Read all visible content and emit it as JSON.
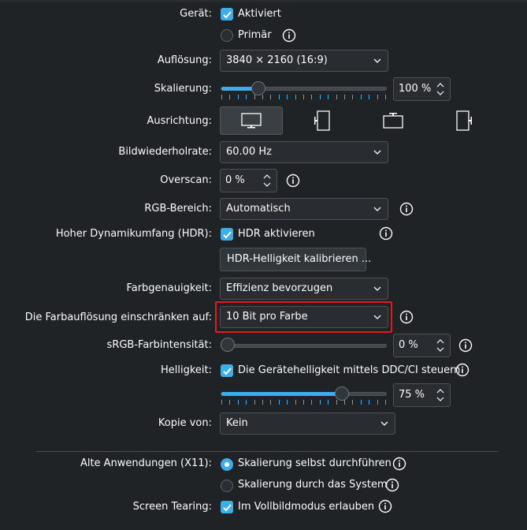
{
  "labels": {
    "device": "Gerät:",
    "resolution": "Auflösung:",
    "scale": "Skalierung:",
    "orientation": "Ausrichtung:",
    "refresh": "Bildwiederholrate:",
    "overscan": "Overscan:",
    "rgb_range": "RGB-Bereich:",
    "hdr": "Hoher Dynamikumfang (HDR):",
    "color_accuracy": "Farbgenauigkeit:",
    "color_depth": "Die Farbauflösung einschränken auf:",
    "srgb": "sRGB-Farbintensität:",
    "brightness": "Helligkeit:",
    "mirror": "Kopie von:",
    "legacy": "Alte Anwendungen (X11):",
    "tearing": "Screen Tearing:"
  },
  "device": {
    "enabled_label": "Aktiviert",
    "enabled": true,
    "primary_label": "Primär",
    "primary": false
  },
  "resolution": {
    "value": "3840 × 2160 (16:9)"
  },
  "scale": {
    "value_text": "100 %",
    "fraction": 0.2
  },
  "orientation": {
    "selected": "landscape"
  },
  "refresh": {
    "value": "60.00 Hz"
  },
  "overscan": {
    "value_text": "0 %"
  },
  "rgb_range": {
    "value": "Automatisch"
  },
  "hdr": {
    "check_label": "HDR aktivieren",
    "checked": true,
    "calibrate_label": "HDR-Helligkeit kalibrieren ..."
  },
  "color_accuracy": {
    "value": "Effizienz bevorzugen"
  },
  "color_depth": {
    "value": "10 Bit pro Farbe"
  },
  "srgb": {
    "value_text": "0 %",
    "fraction": 0.0
  },
  "brightness": {
    "check_label": "Die Gerätehelligkeit mittels DDC/CI steuern",
    "checked": true,
    "value_text": "75 %",
    "fraction": 0.75
  },
  "mirror": {
    "value": "Kein"
  },
  "legacy": {
    "option1": "Skalierung selbst durchführen",
    "option2": "Skalierung durch das System",
    "selected": 1
  },
  "tearing": {
    "check_label": "Im Vollbildmodus erlauben",
    "checked": true
  },
  "colors": {
    "accent": "#3daee9",
    "background": "#202326",
    "highlight": "#e01b1b"
  }
}
